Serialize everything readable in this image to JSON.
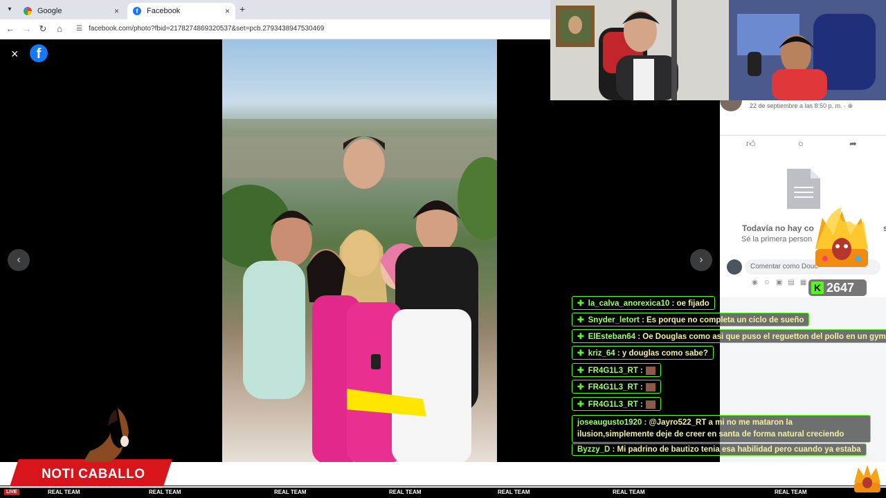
{
  "browser": {
    "tabs": [
      {
        "label": "Google",
        "close": "×"
      },
      {
        "label": "Facebook",
        "close": "×"
      }
    ],
    "new_tab": "+",
    "url": "facebook.com/photo?fbid=2178274869320537&set=pcb.2793438947530469"
  },
  "viewer": {
    "close": "×",
    "logo": "f",
    "prev": "‹",
    "next": "›"
  },
  "side_panel": {
    "date": "22 de septiembre a las 8:50 p. m. · ⊕",
    "no_comments": "Todavía no hay co",
    "no_comments_end": "s",
    "be_first": "Sé la primera person",
    "comment_placeholder": "Comentar como Douc",
    "action_icons": [
      "like-icon",
      "comment-icon",
      "share-icon"
    ]
  },
  "overlay": {
    "counter": "2647",
    "counter_icon": "K",
    "show_title": "NOTI CABALLO",
    "live": "LIVE",
    "ticker": [
      "REAL TEAM",
      "REAL TEAM",
      "REAL TEAM",
      "REAL TEAM",
      "REAL TEAM",
      "REAL TEAM",
      "REAL TEAM"
    ]
  },
  "chat": [
    {
      "user": "la_calva_anorexica10",
      "text": " : oe fijado"
    },
    {
      "user": "Snyder_letort",
      "text": " : Es porque no completa un ciclo de sueño"
    },
    {
      "user": "ElEsteban64",
      "text": " : Oe Douglas como asi que puso el reguetton del pollo en un gym?"
    },
    {
      "user": "kriz_64",
      "text": " : y douglas como sabe?"
    },
    {
      "user": "FR4G1L3_RT",
      "text": " :"
    },
    {
      "user": "FR4G1L3_RT",
      "text": " :"
    },
    {
      "user": "FR4G1L3_RT",
      "text": " :"
    },
    {
      "user": "joseaugusto1920",
      "text": " : @Jayro522_RT a mi no me mataron la ilusion,simplemente deje de creer en santa de forma natural creciendo"
    },
    {
      "user": "Byzzy_D",
      "text": " : Mi padrino de bautizo tenia esa habilidad pero cuando ya estaba"
    }
  ],
  "colors": {
    "facebook_blue": "#1877f2",
    "kick_green": "#53fc18",
    "noti_red": "#d8151b"
  }
}
